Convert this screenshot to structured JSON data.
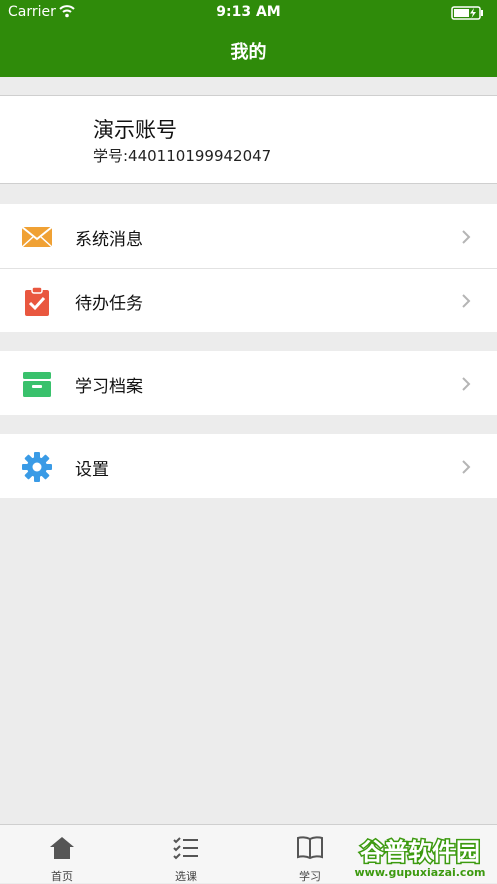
{
  "status_bar": {
    "carrier": "Carrier",
    "time": "9:13 AM"
  },
  "nav": {
    "title": "我的"
  },
  "profile": {
    "name": "演示账号",
    "student_id": "学号:440110199942047"
  },
  "menu": {
    "group1": [
      {
        "label": "系统消息",
        "icon": "envelope-icon",
        "color": "#f0a134"
      },
      {
        "label": "待办任务",
        "icon": "clipboard-check-icon",
        "color": "#e9573f"
      }
    ],
    "group2": [
      {
        "label": "学习档案",
        "icon": "archive-box-icon",
        "color": "#39c16c"
      }
    ],
    "group3": [
      {
        "label": "设置",
        "icon": "gear-icon",
        "color": "#3a9be6"
      }
    ]
  },
  "tabs": [
    {
      "label": "首页",
      "icon": "home-icon"
    },
    {
      "label": "选课",
      "icon": "checklist-icon"
    },
    {
      "label": "学习",
      "icon": "book-icon"
    }
  ],
  "watermark": {
    "title": "谷普软件园",
    "url": "www.gupuxiazai.com"
  },
  "colors": {
    "header": "#2f8b0a",
    "background": "#ececec"
  }
}
